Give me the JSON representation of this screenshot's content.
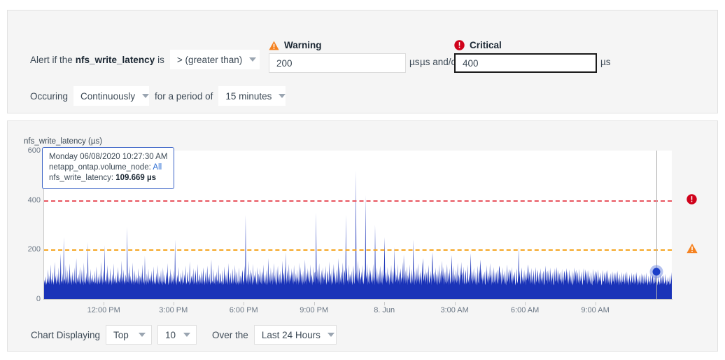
{
  "alert_condition": {
    "prefix_text": "Alert if the",
    "metric_name": "nfs_write_latency",
    "is_text": "is",
    "operator": "> (greater than)",
    "occuring_label": "Occuring",
    "occurrence": "Continuously",
    "period_label": "for a period of",
    "period": "15 minutes",
    "warning": {
      "icon": "warning-triangle-icon",
      "label": "Warning",
      "value": "200",
      "unit": "µs",
      "color": "#f58220"
    },
    "and_or_text": "µs and/or",
    "critical": {
      "icon": "critical-circle-icon",
      "label": "Critical",
      "value": "400",
      "unit": "µs",
      "color": "#d0021b"
    }
  },
  "chart": {
    "title": "nfs_write_latency (µs)",
    "tooltip": {
      "timestamp": "Monday 06/08/2020 10:27:30 AM",
      "series_label": "netapp_ontap.volume_node:",
      "series_value": "All",
      "metric_label": "nfs_write_latency:",
      "metric_value": "109.669 µs"
    },
    "markers": {
      "critical_icon": "critical-circle-icon",
      "warning_icon": "warning-triangle-icon"
    }
  },
  "chart_controls": {
    "displaying_label": "Chart Displaying",
    "rank": "Top",
    "count": "10",
    "over_the_label": "Over the",
    "range": "Last 24 Hours"
  },
  "chart_data": {
    "type": "area",
    "title": "nfs_write_latency (µs)",
    "xlabel": "",
    "ylabel": "nfs_write_latency (µs)",
    "ylim": [
      0,
      600
    ],
    "yticks": [
      0,
      200,
      400,
      600
    ],
    "ytick_labels": [
      "0",
      "200",
      "400",
      "600"
    ],
    "grid": false,
    "legend": null,
    "series_name": "nfs_write_latency",
    "series_color": "#1a33b8",
    "xtick_labels": [
      "12:00 PM",
      "3:00 PM",
      "6:00 PM",
      "9:00 PM",
      "8. Jun",
      "3:00 AM",
      "6:00 AM",
      "9:00 AM"
    ],
    "xtick_positions_pct": [
      9.5,
      20.6,
      31.8,
      43.0,
      54.2,
      65.4,
      76.6,
      87.8
    ],
    "thresholds": [
      {
        "name": "Critical",
        "value": 400,
        "color": "#e8555f",
        "style": "dashed"
      },
      {
        "name": "Warning",
        "value": 200,
        "color": "#f5a623",
        "style": "dashed"
      }
    ],
    "hover_point": {
      "x_pct": 97.6,
      "value": 109.669,
      "label": "109.669 µs"
    },
    "values": [
      62,
      78,
      55,
      92,
      70,
      58,
      85,
      64,
      120,
      72,
      60,
      95,
      68,
      140,
      58,
      82,
      66,
      110,
      74,
      57,
      88,
      150,
      63,
      96,
      71,
      59,
      104,
      80,
      66,
      128,
      70,
      55,
      92,
      185,
      68,
      76,
      61,
      105,
      58,
      250,
      72,
      84,
      60,
      138,
      66,
      93,
      57,
      118,
      70,
      61,
      86,
      144,
      64,
      99,
      75,
      56,
      112,
      68,
      80,
      59,
      128,
      70,
      62,
      95,
      165,
      57,
      88,
      73,
      66,
      102,
      60,
      131,
      69,
      58,
      84,
      120,
      65,
      77,
      55,
      148,
      71,
      62,
      90,
      58,
      108,
      67,
      79,
      230,
      61,
      95,
      70,
      56,
      122,
      64,
      86,
      59,
      100,
      73,
      66,
      88,
      57,
      115,
      69,
      61,
      132,
      75,
      58,
      92,
      66,
      104,
      70,
      60,
      85,
      150,
      63,
      97,
      56,
      118,
      72,
      64,
      218,
      68,
      79,
      58,
      110,
      66,
      138,
      74,
      57,
      90,
      62,
      125,
      69,
      80,
      55,
      102,
      73,
      60,
      144,
      67,
      86,
      59,
      98,
      71,
      63,
      112,
      57,
      130,
      75,
      66,
      88,
      60,
      105,
      68,
      155,
      58,
      92,
      70,
      120,
      64,
      76,
      57,
      100,
      85,
      62,
      290,
      72,
      66,
      108,
      59,
      135,
      70,
      95,
      61,
      82,
      58,
      148,
      67,
      78,
      56,
      118,
      74,
      63,
      102,
      69,
      88,
      60,
      125,
      72,
      57,
      96,
      84,
      66,
      110,
      58,
      140,
      71,
      62,
      90,
      55,
      175,
      68,
      80,
      57,
      104,
      73,
      64,
      122,
      59,
      86,
      70,
      98,
      61,
      115,
      66,
      78,
      56,
      132,
      74,
      60,
      92,
      69,
      58,
      106,
      80,
      63,
      138,
      71,
      57,
      95,
      84,
      66,
      118,
      60,
      76,
      55,
      128,
      72,
      62,
      100,
      68,
      58,
      88,
      110,
      64,
      145,
      70,
      56,
      82,
      96,
      61,
      124,
      73,
      59,
      104,
      66,
      86,
      57,
      116,
      70,
      240,
      62,
      78,
      55,
      98,
      85,
      60,
      130,
      68,
      74,
      58,
      108,
      66,
      92,
      56,
      120,
      71,
      63,
      84,
      100,
      57,
      136,
      69,
      59,
      88,
      112,
      64,
      76,
      55,
      152,
      72,
      61,
      95,
      82,
      66,
      105,
      58,
      126,
      70,
      60,
      90,
      118,
      63,
      74,
      56,
      142,
      68,
      80,
      57,
      102,
      86,
      62,
      115,
      70,
      59,
      96,
      128,
      65,
      78,
      55,
      110,
      73,
      61,
      88,
      135,
      58,
      92,
      66,
      104,
      70,
      57,
      84,
      160,
      64,
      76,
      59,
      122,
      71,
      62,
      98,
      86,
      55,
      112,
      68,
      80,
      57,
      140,
      74,
      60,
      94,
      106,
      63,
      75,
      56,
      118,
      70,
      58,
      88,
      132,
      66,
      101,
      60,
      82,
      115,
      57,
      72,
      145,
      64,
      92,
      55,
      108,
      70,
      61,
      86,
      124,
      59,
      78,
      100,
      66,
      138,
      70,
      57,
      90,
      112,
      62,
      76,
      55,
      128,
      73,
      60,
      96,
      84,
      58,
      105,
      118,
      65,
      77,
      56,
      135,
      71,
      340,
      88,
      62,
      102,
      74,
      57,
      155,
      66,
      92,
      120,
      59,
      80,
      108,
      70,
      56,
      142,
      64,
      86,
      98,
      61,
      115,
      72,
      58,
      130,
      78,
      55,
      104,
      88,
      66,
      125,
      70,
      60,
      95,
      112,
      57,
      140,
      74,
      62,
      82,
      100,
      58,
      118,
      68,
      56,
      92,
      165,
      63,
      76,
      105,
      59,
      128,
      70,
      80,
      110,
      57,
      88,
      145,
      66,
      98,
      60,
      122,
      72,
      55,
      90,
      135,
      64,
      78,
      102,
      58,
      115,
      70,
      61,
      85,
      155,
      67,
      94,
      108,
      56,
      132,
      73,
      190,
      60,
      88,
      118,
      65,
      77,
      142,
      59,
      100,
      86,
      70,
      125,
      62,
      95,
      112,
      57,
      138,
      74,
      66,
      82,
      105,
      58,
      120,
      70,
      90,
      56,
      148,
      64,
      78,
      130,
      61,
      102,
      88,
      55,
      115,
      72,
      60,
      95,
      160,
      68,
      84,
      108,
      57,
      126,
      70,
      92,
      118,
      63,
      76,
      140,
      59,
      100,
      86,
      55,
      132,
      71,
      66,
      105,
      112,
      58,
      350,
      95,
      78,
      122,
      60,
      88,
      145,
      65,
      102,
      70,
      56,
      118,
      82,
      128,
      59,
      92,
      75,
      108,
      62,
      135,
      70,
      57,
      98,
      115,
      66,
      80,
      152,
      61,
      88,
      105,
      55,
      125,
      73,
      60,
      94,
      142,
      68,
      110,
      85,
      58,
      120,
      70,
      64,
      100,
      165,
      57,
      78,
      130,
      66,
      92,
      112,
      60,
      86,
      148,
      72,
      55,
      104,
      118,
      63,
      340,
      96,
      128,
      70,
      80,
      58,
      140,
      66,
      102,
      88,
      61,
      115,
      70,
      56,
      95,
      135,
      72,
      60,
      108,
      82,
      520,
      118,
      70,
      88,
      155,
      62,
      100,
      128,
      57,
      92,
      76,
      112,
      66,
      138,
      70,
      59,
      86,
      122,
      64,
      420,
      98,
      80,
      145,
      56,
      110,
      72,
      60,
      130,
      88,
      118,
      65,
      77,
      102,
      58,
      142,
      70,
      92,
      55,
      300,
      115,
      66,
      84,
      128,
      60,
      105,
      70,
      58,
      96,
      135,
      72,
      62,
      88,
      118,
      56,
      100,
      80,
      148,
      250,
      70,
      92,
      110,
      64,
      76,
      130,
      59,
      102,
      86,
      55,
      120,
      68,
      138,
      72,
      60,
      94,
      115,
      58,
      210,
      88,
      128,
      66,
      78,
      100,
      61,
      142,
      70,
      84,
      112,
      57,
      96,
      125,
      65,
      90,
      80,
      150,
      59,
      180,
      104,
      70,
      118,
      62,
      86,
      132,
      56,
      98,
      75,
      110,
      66,
      140,
      70,
      60,
      88,
      122,
      64,
      102,
      240,
      80,
      56,
      115,
      70,
      92,
      128,
      61,
      84,
      145,
      66,
      100,
      58,
      108,
      74,
      118,
      55,
      90,
      135,
      165,
      70,
      82,
      105,
      60,
      125,
      68,
      96,
      112,
      57,
      88,
      138,
      72,
      62,
      100,
      80,
      115,
      56,
      148,
      190,
      70,
      94,
      110,
      64,
      78,
      128,
      58,
      102,
      86,
      55,
      120,
      66,
      140,
      70,
      60,
      92,
      118,
      63,
      155,
      100,
      80,
      130,
      57,
      88,
      112,
      70,
      61,
      98,
      142,
      66,
      84,
      108,
      55,
      125,
      72,
      60,
      94,
      178,
      118,
      66,
      80,
      135,
      58,
      102,
      70,
      90,
      120,
      64,
      76,
      148,
      59,
      100,
      86,
      55,
      128,
      72,
      150,
      95,
      110,
      62,
      84,
      132,
      68,
      58,
      100,
      118,
      70,
      60,
      88,
      140,
      65,
      78,
      105,
      56,
      122,
      185,
      70,
      92,
      115,
      60,
      80,
      128,
      66,
      98,
      58,
      110,
      72,
      55,
      86,
      135,
      70,
      62,
      100,
      118,
      160,
      88,
      75,
      125,
      58,
      102,
      70,
      90,
      112,
      64,
      56,
      118,
      80,
      138,
      66,
      95,
      60,
      108,
      72,
      145,
      84,
      100,
      55,
      120,
      70,
      62,
      92,
      130,
      66,
      78,
      110,
      58,
      98,
      118,
      70,
      60,
      86,
      125,
      135,
      72,
      95,
      112,
      57,
      80,
      128,
      66,
      102,
      60,
      88,
      115,
      70,
      55,
      92,
      140,
      68,
      78,
      105,
      122,
      60,
      96,
      118,
      64,
      84,
      130,
      58,
      100,
      70,
      90,
      112,
      66,
      55,
      86,
      125,
      72,
      62,
      98,
      210,
      80,
      115,
      68,
      58,
      100,
      128,
      70,
      92,
      60,
      84,
      118,
      66,
      102,
      55,
      110,
      74,
      88,
      120,
      140,
      70,
      95,
      112,
      60,
      80,
      126,
      64,
      98,
      58,
      86,
      118,
      70,
      55,
      90,
      130,
      66,
      78,
      104,
      118,
      62,
      96,
      110,
      58,
      82,
      125,
      70,
      88,
      60,
      100,
      115,
      64,
      55,
      92,
      135,
      72,
      78,
      106,
      115,
      60,
      98,
      120,
      66,
      84,
      128,
      56,
      100,
      70,
      88,
      112,
      62,
      55,
      94,
      125,
      70,
      76,
      102,
      130,
      64,
      88,
      118,
      58,
      96,
      110,
      70,
      84,
      60,
      122,
      66,
      92,
      55,
      105,
      115,
      72,
      80,
      100,
      125,
      62,
      94,
      112,
      58,
      86,
      120,
      68,
      98,
      60,
      78,
      115,
      64,
      55,
      90,
      128,
      70,
      82,
      104,
      118,
      60,
      92,
      110,
      64,
      80,
      122,
      58,
      96,
      70,
      86,
      112,
      66,
      55,
      88,
      125,
      72,
      78,
      100,
      120,
      62,
      90,
      115,
      58,
      84,
      118,
      66,
      94,
      60,
      80,
      110,
      64,
      55,
      86,
      122,
      70,
      76,
      98,
      115,
      60,
      88,
      112,
      58,
      82,
      120,
      66,
      92,
      70,
      78,
      108,
      62,
      55,
      84,
      118,
      70,
      74,
      96,
      110,
      58,
      86,
      115,
      60,
      80,
      118,
      64,
      90,
      56,
      76,
      105,
      68,
      55,
      82,
      112,
      70,
      72,
      94,
      108,
      58,
      84,
      110,
      62,
      78,
      115,
      66,
      88,
      55,
      74,
      102,
      64,
      80,
      56,
      110,
      70,
      68,
      92,
      105,
      58,
      82,
      108,
      60,
      76,
      112,
      64,
      86,
      55,
      72,
      100,
      66,
      78,
      56,
      108,
      70,
      64,
      90,
      102,
      58,
      80,
      105,
      62,
      74,
      110,
      66,
      84,
      55,
      70,
      98,
      64,
      76,
      56,
      105,
      68,
      62,
      88,
      100,
      58,
      78,
      102,
      60,
      72,
      108,
      64,
      82,
      55,
      68,
      95,
      66,
      74,
      56,
      102,
      70,
      60,
      86,
      98,
      58,
      76,
      100,
      62,
      70,
      105,
      64,
      80,
      55,
      66,
      92,
      68,
      72,
      56,
      100,
      66,
      60,
      84,
      95,
      58,
      74,
      98,
      60,
      68,
      102,
      66,
      78,
      55,
      64,
      90,
      70,
      72,
      56,
      98,
      64,
      60,
      82,
      109
    ]
  }
}
